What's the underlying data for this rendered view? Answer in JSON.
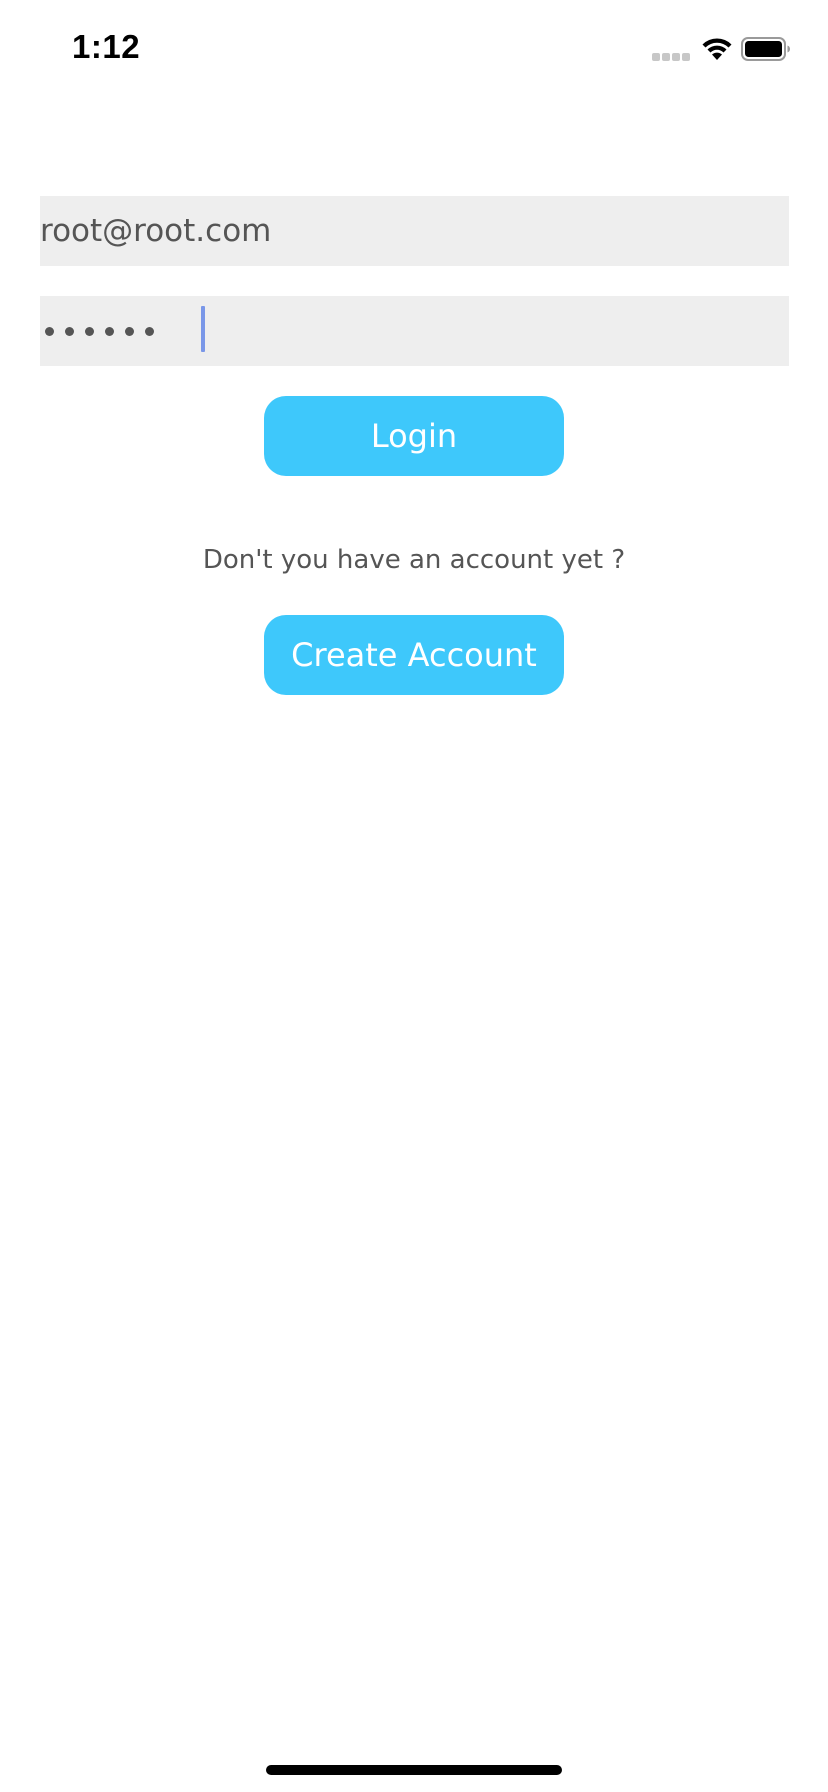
{
  "status_bar": {
    "time": "1:12",
    "icons": [
      "cellular-signal-icon",
      "wifi-icon",
      "battery-icon"
    ]
  },
  "form": {
    "email": {
      "value": "root@root.com",
      "placeholder": ""
    },
    "password": {
      "masked_length": 6,
      "has_focus": true
    },
    "login_label": "Login",
    "prompt_text": "Don't you have an account yet ?",
    "create_account_label": "Create Account"
  },
  "colors": {
    "accent": "#3ec8fb",
    "field_background": "#eeeeee",
    "text_muted": "#555555",
    "caret": "#7a97e8"
  }
}
